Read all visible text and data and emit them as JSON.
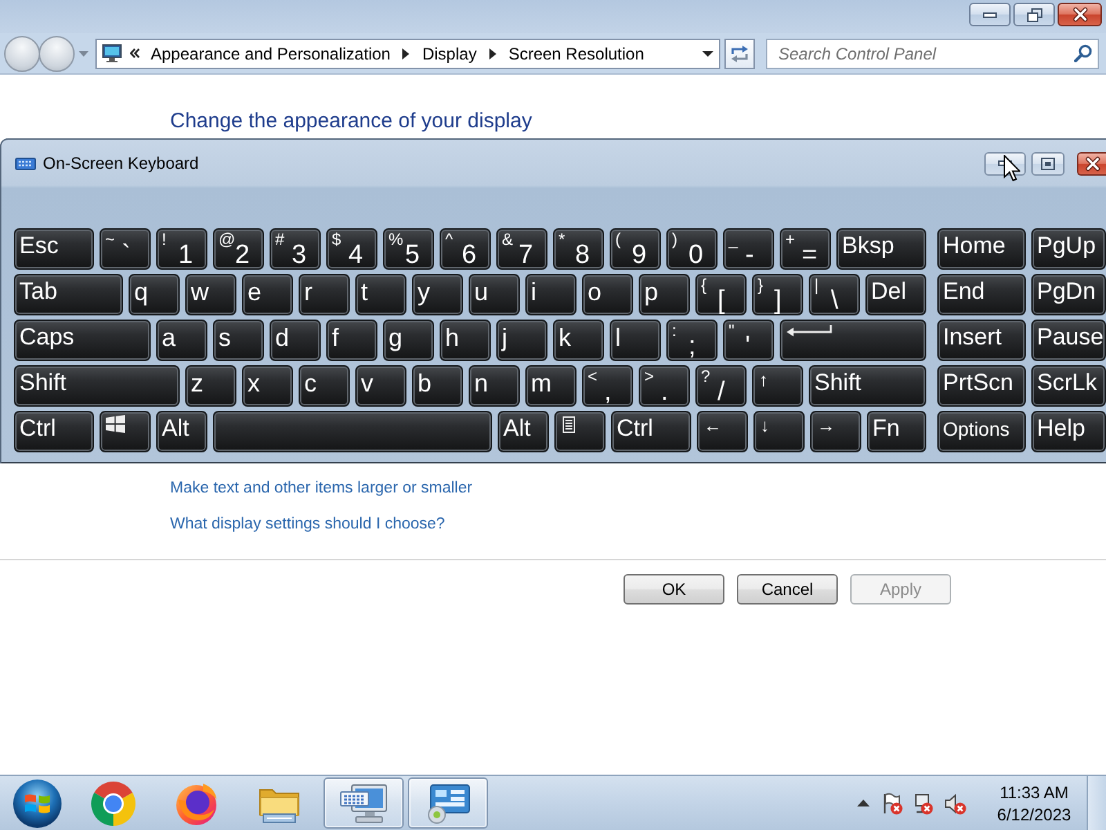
{
  "navigation": {
    "back": {
      "disabled": true
    },
    "forward": {
      "disabled": true
    },
    "breadcrumbs": [
      "Appearance and Personalization",
      "Display",
      "Screen Resolution"
    ],
    "search": {
      "placeholder": "Search Control Panel"
    }
  },
  "heading": "Change the appearance of your display",
  "on_screen_keyboard": {
    "title": "On-Screen Keyboard",
    "main_rows": [
      [
        {
          "kind": "word",
          "label": "Esc"
        },
        {
          "kind": "symbol",
          "shift": "~",
          "label": "`"
        },
        {
          "kind": "symbol",
          "shift": "!",
          "label": "1"
        },
        {
          "kind": "symbol",
          "shift": "@",
          "label": "2"
        },
        {
          "kind": "symbol",
          "shift": "#",
          "label": "3"
        },
        {
          "kind": "symbol",
          "shift": "$",
          "label": "4"
        },
        {
          "kind": "symbol",
          "shift": "%",
          "label": "5"
        },
        {
          "kind": "symbol",
          "shift": "^",
          "label": "6"
        },
        {
          "kind": "symbol",
          "shift": "&",
          "label": "7"
        },
        {
          "kind": "symbol",
          "shift": "*",
          "label": "8"
        },
        {
          "kind": "symbol",
          "shift": "(",
          "label": "9"
        },
        {
          "kind": "symbol",
          "shift": ")",
          "label": "0"
        },
        {
          "kind": "symbol",
          "shift": "_",
          "label": "-"
        },
        {
          "kind": "symbol",
          "shift": "+",
          "label": "="
        },
        {
          "kind": "word",
          "label": "Bksp"
        }
      ],
      [
        {
          "kind": "word",
          "label": "Tab"
        },
        {
          "kind": "letter",
          "label": "q"
        },
        {
          "kind": "letter",
          "label": "w"
        },
        {
          "kind": "letter",
          "label": "e"
        },
        {
          "kind": "letter",
          "label": "r"
        },
        {
          "kind": "letter",
          "label": "t"
        },
        {
          "kind": "letter",
          "label": "y"
        },
        {
          "kind": "letter",
          "label": "u"
        },
        {
          "kind": "letter",
          "label": "i"
        },
        {
          "kind": "letter",
          "label": "o"
        },
        {
          "kind": "letter",
          "label": "p"
        },
        {
          "kind": "symbol",
          "shift": "{",
          "label": "["
        },
        {
          "kind": "symbol",
          "shift": "}",
          "label": "]"
        },
        {
          "kind": "symbol",
          "shift": "|",
          "label": "\\"
        },
        {
          "kind": "word",
          "label": "Del"
        }
      ],
      [
        {
          "kind": "word",
          "label": "Caps"
        },
        {
          "kind": "letter",
          "label": "a"
        },
        {
          "kind": "letter",
          "label": "s"
        },
        {
          "kind": "letter",
          "label": "d"
        },
        {
          "kind": "letter",
          "label": "f"
        },
        {
          "kind": "letter",
          "label": "g"
        },
        {
          "kind": "letter",
          "label": "h"
        },
        {
          "kind": "letter",
          "label": "j"
        },
        {
          "kind": "letter",
          "label": "k"
        },
        {
          "kind": "letter",
          "label": "l"
        },
        {
          "kind": "symbol",
          "shift": ":",
          "label": ";"
        },
        {
          "kind": "symbol",
          "shift": "\"",
          "label": "'"
        },
        {
          "kind": "enter"
        }
      ],
      [
        {
          "kind": "word",
          "label": "Shift"
        },
        {
          "kind": "letter",
          "label": "z"
        },
        {
          "kind": "letter",
          "label": "x"
        },
        {
          "kind": "letter",
          "label": "c"
        },
        {
          "kind": "letter",
          "label": "v"
        },
        {
          "kind": "letter",
          "label": "b"
        },
        {
          "kind": "letter",
          "label": "n"
        },
        {
          "kind": "letter",
          "label": "m"
        },
        {
          "kind": "symbol",
          "shift": "<",
          "label": ","
        },
        {
          "kind": "symbol",
          "shift": ">",
          "label": "."
        },
        {
          "kind": "symbol",
          "shift": "?",
          "label": "/"
        },
        {
          "kind": "arrow",
          "label": "↑"
        },
        {
          "kind": "word",
          "label": "Shift"
        }
      ],
      [
        {
          "kind": "word",
          "label": "Ctrl"
        },
        {
          "kind": "windows"
        },
        {
          "kind": "word",
          "label": "Alt"
        },
        {
          "kind": "space"
        },
        {
          "kind": "word",
          "label": "Alt"
        },
        {
          "kind": "menu"
        },
        {
          "kind": "word",
          "label": "Ctrl"
        },
        {
          "kind": "arrow",
          "label": "←"
        },
        {
          "kind": "arrow",
          "label": "↓"
        },
        {
          "kind": "arrow",
          "label": "→"
        },
        {
          "kind": "word",
          "label": "Fn"
        }
      ]
    ],
    "side_rows": [
      [
        {
          "kind": "word",
          "label": "Home"
        },
        {
          "kind": "word",
          "label": "PgUp"
        }
      ],
      [
        {
          "kind": "word",
          "label": "End"
        },
        {
          "kind": "word",
          "label": "PgDn"
        }
      ],
      [
        {
          "kind": "word",
          "label": "Insert"
        },
        {
          "kind": "word",
          "label": "Pause"
        }
      ],
      [
        {
          "kind": "word",
          "label": "PrtScn"
        },
        {
          "kind": "word",
          "label": "ScrLk"
        }
      ],
      [
        {
          "kind": "small_word",
          "label": "Options"
        },
        {
          "kind": "word",
          "label": "Help"
        }
      ]
    ]
  },
  "links": [
    "Make text and other items larger or smaller",
    "What display settings should I choose?"
  ],
  "buttons": [
    {
      "label": "OK",
      "disabled": false
    },
    {
      "label": "Cancel",
      "disabled": false
    },
    {
      "label": "Apply",
      "disabled": true
    }
  ],
  "taskbar": {
    "apps": [
      {
        "kind": "chrome",
        "running": false
      },
      {
        "kind": "firefox",
        "running": false
      },
      {
        "kind": "explorer",
        "running": false
      },
      {
        "kind": "osk",
        "running": true
      },
      {
        "kind": "control_panel",
        "running": true
      }
    ],
    "clock": {
      "time": "11:33 AM",
      "date": "6/12/2023"
    }
  }
}
